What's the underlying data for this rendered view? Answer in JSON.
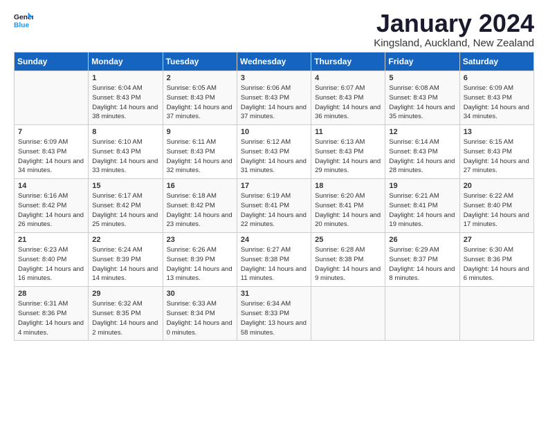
{
  "header": {
    "logo_line1": "General",
    "logo_line2": "Blue",
    "month": "January 2024",
    "location": "Kingsland, Auckland, New Zealand"
  },
  "days_of_week": [
    "Sunday",
    "Monday",
    "Tuesday",
    "Wednesday",
    "Thursday",
    "Friday",
    "Saturday"
  ],
  "weeks": [
    [
      {
        "day": "",
        "sunrise": "",
        "sunset": "",
        "daylight": ""
      },
      {
        "day": "1",
        "sunrise": "Sunrise: 6:04 AM",
        "sunset": "Sunset: 8:43 PM",
        "daylight": "Daylight: 14 hours and 38 minutes."
      },
      {
        "day": "2",
        "sunrise": "Sunrise: 6:05 AM",
        "sunset": "Sunset: 8:43 PM",
        "daylight": "Daylight: 14 hours and 37 minutes."
      },
      {
        "day": "3",
        "sunrise": "Sunrise: 6:06 AM",
        "sunset": "Sunset: 8:43 PM",
        "daylight": "Daylight: 14 hours and 37 minutes."
      },
      {
        "day": "4",
        "sunrise": "Sunrise: 6:07 AM",
        "sunset": "Sunset: 8:43 PM",
        "daylight": "Daylight: 14 hours and 36 minutes."
      },
      {
        "day": "5",
        "sunrise": "Sunrise: 6:08 AM",
        "sunset": "Sunset: 8:43 PM",
        "daylight": "Daylight: 14 hours and 35 minutes."
      },
      {
        "day": "6",
        "sunrise": "Sunrise: 6:09 AM",
        "sunset": "Sunset: 8:43 PM",
        "daylight": "Daylight: 14 hours and 34 minutes."
      }
    ],
    [
      {
        "day": "7",
        "sunrise": "Sunrise: 6:09 AM",
        "sunset": "Sunset: 8:43 PM",
        "daylight": "Daylight: 14 hours and 34 minutes."
      },
      {
        "day": "8",
        "sunrise": "Sunrise: 6:10 AM",
        "sunset": "Sunset: 8:43 PM",
        "daylight": "Daylight: 14 hours and 33 minutes."
      },
      {
        "day": "9",
        "sunrise": "Sunrise: 6:11 AM",
        "sunset": "Sunset: 8:43 PM",
        "daylight": "Daylight: 14 hours and 32 minutes."
      },
      {
        "day": "10",
        "sunrise": "Sunrise: 6:12 AM",
        "sunset": "Sunset: 8:43 PM",
        "daylight": "Daylight: 14 hours and 31 minutes."
      },
      {
        "day": "11",
        "sunrise": "Sunrise: 6:13 AM",
        "sunset": "Sunset: 8:43 PM",
        "daylight": "Daylight: 14 hours and 29 minutes."
      },
      {
        "day": "12",
        "sunrise": "Sunrise: 6:14 AM",
        "sunset": "Sunset: 8:43 PM",
        "daylight": "Daylight: 14 hours and 28 minutes."
      },
      {
        "day": "13",
        "sunrise": "Sunrise: 6:15 AM",
        "sunset": "Sunset: 8:43 PM",
        "daylight": "Daylight: 14 hours and 27 minutes."
      }
    ],
    [
      {
        "day": "14",
        "sunrise": "Sunrise: 6:16 AM",
        "sunset": "Sunset: 8:42 PM",
        "daylight": "Daylight: 14 hours and 26 minutes."
      },
      {
        "day": "15",
        "sunrise": "Sunrise: 6:17 AM",
        "sunset": "Sunset: 8:42 PM",
        "daylight": "Daylight: 14 hours and 25 minutes."
      },
      {
        "day": "16",
        "sunrise": "Sunrise: 6:18 AM",
        "sunset": "Sunset: 8:42 PM",
        "daylight": "Daylight: 14 hours and 23 minutes."
      },
      {
        "day": "17",
        "sunrise": "Sunrise: 6:19 AM",
        "sunset": "Sunset: 8:41 PM",
        "daylight": "Daylight: 14 hours and 22 minutes."
      },
      {
        "day": "18",
        "sunrise": "Sunrise: 6:20 AM",
        "sunset": "Sunset: 8:41 PM",
        "daylight": "Daylight: 14 hours and 20 minutes."
      },
      {
        "day": "19",
        "sunrise": "Sunrise: 6:21 AM",
        "sunset": "Sunset: 8:41 PM",
        "daylight": "Daylight: 14 hours and 19 minutes."
      },
      {
        "day": "20",
        "sunrise": "Sunrise: 6:22 AM",
        "sunset": "Sunset: 8:40 PM",
        "daylight": "Daylight: 14 hours and 17 minutes."
      }
    ],
    [
      {
        "day": "21",
        "sunrise": "Sunrise: 6:23 AM",
        "sunset": "Sunset: 8:40 PM",
        "daylight": "Daylight: 14 hours and 16 minutes."
      },
      {
        "day": "22",
        "sunrise": "Sunrise: 6:24 AM",
        "sunset": "Sunset: 8:39 PM",
        "daylight": "Daylight: 14 hours and 14 minutes."
      },
      {
        "day": "23",
        "sunrise": "Sunrise: 6:26 AM",
        "sunset": "Sunset: 8:39 PM",
        "daylight": "Daylight: 14 hours and 13 minutes."
      },
      {
        "day": "24",
        "sunrise": "Sunrise: 6:27 AM",
        "sunset": "Sunset: 8:38 PM",
        "daylight": "Daylight: 14 hours and 11 minutes."
      },
      {
        "day": "25",
        "sunrise": "Sunrise: 6:28 AM",
        "sunset": "Sunset: 8:38 PM",
        "daylight": "Daylight: 14 hours and 9 minutes."
      },
      {
        "day": "26",
        "sunrise": "Sunrise: 6:29 AM",
        "sunset": "Sunset: 8:37 PM",
        "daylight": "Daylight: 14 hours and 8 minutes."
      },
      {
        "day": "27",
        "sunrise": "Sunrise: 6:30 AM",
        "sunset": "Sunset: 8:36 PM",
        "daylight": "Daylight: 14 hours and 6 minutes."
      }
    ],
    [
      {
        "day": "28",
        "sunrise": "Sunrise: 6:31 AM",
        "sunset": "Sunset: 8:36 PM",
        "daylight": "Daylight: 14 hours and 4 minutes."
      },
      {
        "day": "29",
        "sunrise": "Sunrise: 6:32 AM",
        "sunset": "Sunset: 8:35 PM",
        "daylight": "Daylight: 14 hours and 2 minutes."
      },
      {
        "day": "30",
        "sunrise": "Sunrise: 6:33 AM",
        "sunset": "Sunset: 8:34 PM",
        "daylight": "Daylight: 14 hours and 0 minutes."
      },
      {
        "day": "31",
        "sunrise": "Sunrise: 6:34 AM",
        "sunset": "Sunset: 8:33 PM",
        "daylight": "Daylight: 13 hours and 58 minutes."
      },
      {
        "day": "",
        "sunrise": "",
        "sunset": "",
        "daylight": ""
      },
      {
        "day": "",
        "sunrise": "",
        "sunset": "",
        "daylight": ""
      },
      {
        "day": "",
        "sunrise": "",
        "sunset": "",
        "daylight": ""
      }
    ]
  ]
}
